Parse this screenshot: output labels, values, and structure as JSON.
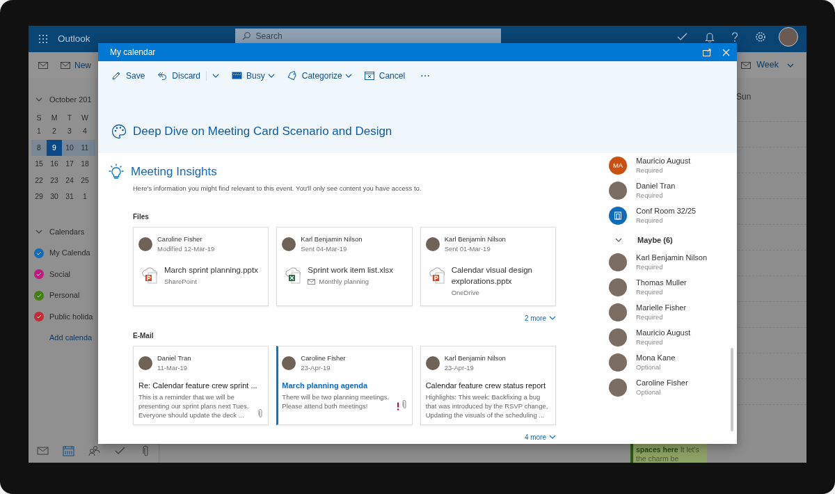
{
  "app_bar": {
    "app_name": "Outlook",
    "search_placeholder": "Search"
  },
  "command_bar": {
    "new_label": "New",
    "view_label": "Week"
  },
  "mini_calendar": {
    "month": "October 201",
    "expanded": true,
    "weekdays": [
      "S",
      "M",
      "T",
      "W"
    ],
    "weeks": [
      {
        "selected": false,
        "days": [
          {
            "label": "1",
            "selected": false
          },
          {
            "label": "2",
            "selected": false
          },
          {
            "label": "3",
            "selected": false
          },
          {
            "label": "4",
            "selected": false
          }
        ]
      },
      {
        "selected": true,
        "days": [
          {
            "label": "8",
            "selected": false
          },
          {
            "label": "9",
            "selected": true
          },
          {
            "label": "10",
            "selected": false
          },
          {
            "label": "11",
            "selected": false
          }
        ]
      },
      {
        "selected": false,
        "days": [
          {
            "label": "15",
            "selected": false
          },
          {
            "label": "16",
            "selected": false
          },
          {
            "label": "17",
            "selected": false
          },
          {
            "label": "18",
            "selected": false
          }
        ]
      },
      {
        "selected": false,
        "days": [
          {
            "label": "22",
            "selected": false
          },
          {
            "label": "23",
            "selected": false
          },
          {
            "label": "24",
            "selected": false
          },
          {
            "label": "25",
            "selected": false
          }
        ]
      },
      {
        "selected": false,
        "days": [
          {
            "label": "29",
            "selected": false
          },
          {
            "label": "30",
            "selected": false
          },
          {
            "label": "31",
            "selected": false
          },
          {
            "label": "1",
            "selected": false
          }
        ]
      }
    ]
  },
  "calendars": {
    "heading": "Calendars",
    "expanded": true,
    "items": [
      {
        "name": "My Calenda",
        "color": "#0f6cbd",
        "checked": true
      },
      {
        "name": "Social",
        "color": "#c2177f",
        "checked": true
      },
      {
        "name": "Personal",
        "color": "#43810f",
        "checked": true
      },
      {
        "name": "Public holida",
        "color": "#c42b32",
        "checked": true
      }
    ],
    "add_link": "Add calenda"
  },
  "bottom_nav": [
    {
      "kind": "mail",
      "selected": false
    },
    {
      "kind": "calendar",
      "selected": true
    },
    {
      "kind": "people",
      "selected": false
    },
    {
      "kind": "tasks",
      "selected": false
    },
    {
      "kind": "attach",
      "selected": false
    }
  ],
  "week_view": {
    "day_label": "Sun",
    "event_text": "**spaces here** It let's the charm be"
  },
  "dialog": {
    "title": "My calendar",
    "toolbar": [
      {
        "kind": "save",
        "label": "Save"
      },
      {
        "kind": "discard",
        "label": "Discard"
      },
      {
        "kind": "busy",
        "label": "Busy"
      },
      {
        "kind": "categorize",
        "label": "Categorize"
      },
      {
        "kind": "cancel",
        "label": "Cancel"
      },
      {
        "kind": "more",
        "label": "⋯"
      }
    ],
    "event_title": "Deep Dive on Meeting Card Scenario and Design",
    "insights": {
      "title": "Meeting Insights",
      "description": "Here's information you might find relevant to this event. You'll only see content you have access to.",
      "files": {
        "heading": "Files",
        "more": "2 more",
        "items": [
          {
            "kind": "presentation",
            "person": "Caroline Fisher",
            "date": "Modified 12-Mar-19",
            "file_name": "March sprint planning.pptx",
            "source": "SharePoint",
            "via_mail": false
          },
          {
            "kind": "spreadsheet",
            "person": "Karl Benjamin Nilson",
            "date": "Sent 04-Mar-19",
            "file_name": "Sprint work item list.xlsx",
            "source": "Monthly planning",
            "via_mail": true
          },
          {
            "kind": "presentation",
            "person": "Karl Benjamin Nilson",
            "date": "Sent 01-Mar-19",
            "file_name": "Calendar visual design explorations.pptx",
            "source": "OneDrive",
            "via_mail": false
          }
        ]
      },
      "emails": {
        "heading": "E-Mail",
        "more": "4 more",
        "items": [
          {
            "person": "Daniel Tran",
            "date": "11-Mar-19",
            "subject": "Re: Calendar feature crew sprint ...",
            "preview": "This is a reminder that we will be presenting our sprint plans next Tues. Everyone should update the deck ...",
            "unread": false,
            "important": false,
            "attachment": true
          },
          {
            "person": "Caroline Fisher",
            "date": "23-Apr-19",
            "subject": "March planning agenda",
            "preview": "There will be two planning meetings. Please attend both meetings!",
            "unread": true,
            "important": true,
            "attachment": true
          },
          {
            "person": "Karl Benjamin Nilson",
            "date": "23-Apr-19",
            "subject": "Calendar feature crew status report",
            "preview": "Highlights:  This week:  Backfixing a bug that was introduced by the RSVP change, Updating the visuals of the scheduling ...",
            "unread": false,
            "important": false,
            "attachment": false
          }
        ]
      }
    },
    "attendees": [
      {
        "kind": "initials",
        "name": "Mauricio August",
        "role": "Required",
        "initials": "MA",
        "color": "#ca5010"
      },
      {
        "kind": "photo",
        "name": "Daniel Tran",
        "role": "Required"
      },
      {
        "kind": "room",
        "name": "Conf Room 32/25",
        "role": "Required"
      }
    ],
    "attendee_groups": [
      {
        "label": "Maybe (6)",
        "expanded": true,
        "children": [
          {
            "kind": "photo",
            "name": "Karl Benjamin Nilson",
            "role": "Required"
          },
          {
            "kind": "photo",
            "name": "Thomas Muller",
            "role": "Required"
          },
          {
            "kind": "photo",
            "name": "Marielle Fisher",
            "role": "Required"
          },
          {
            "kind": "photo",
            "name": "Mauricio August",
            "role": "Required"
          },
          {
            "kind": "photo",
            "name": "Mona Kane",
            "role": "Optional"
          },
          {
            "kind": "photo",
            "name": "Caroline Fisher",
            "role": "Optional"
          }
        ]
      }
    ]
  }
}
